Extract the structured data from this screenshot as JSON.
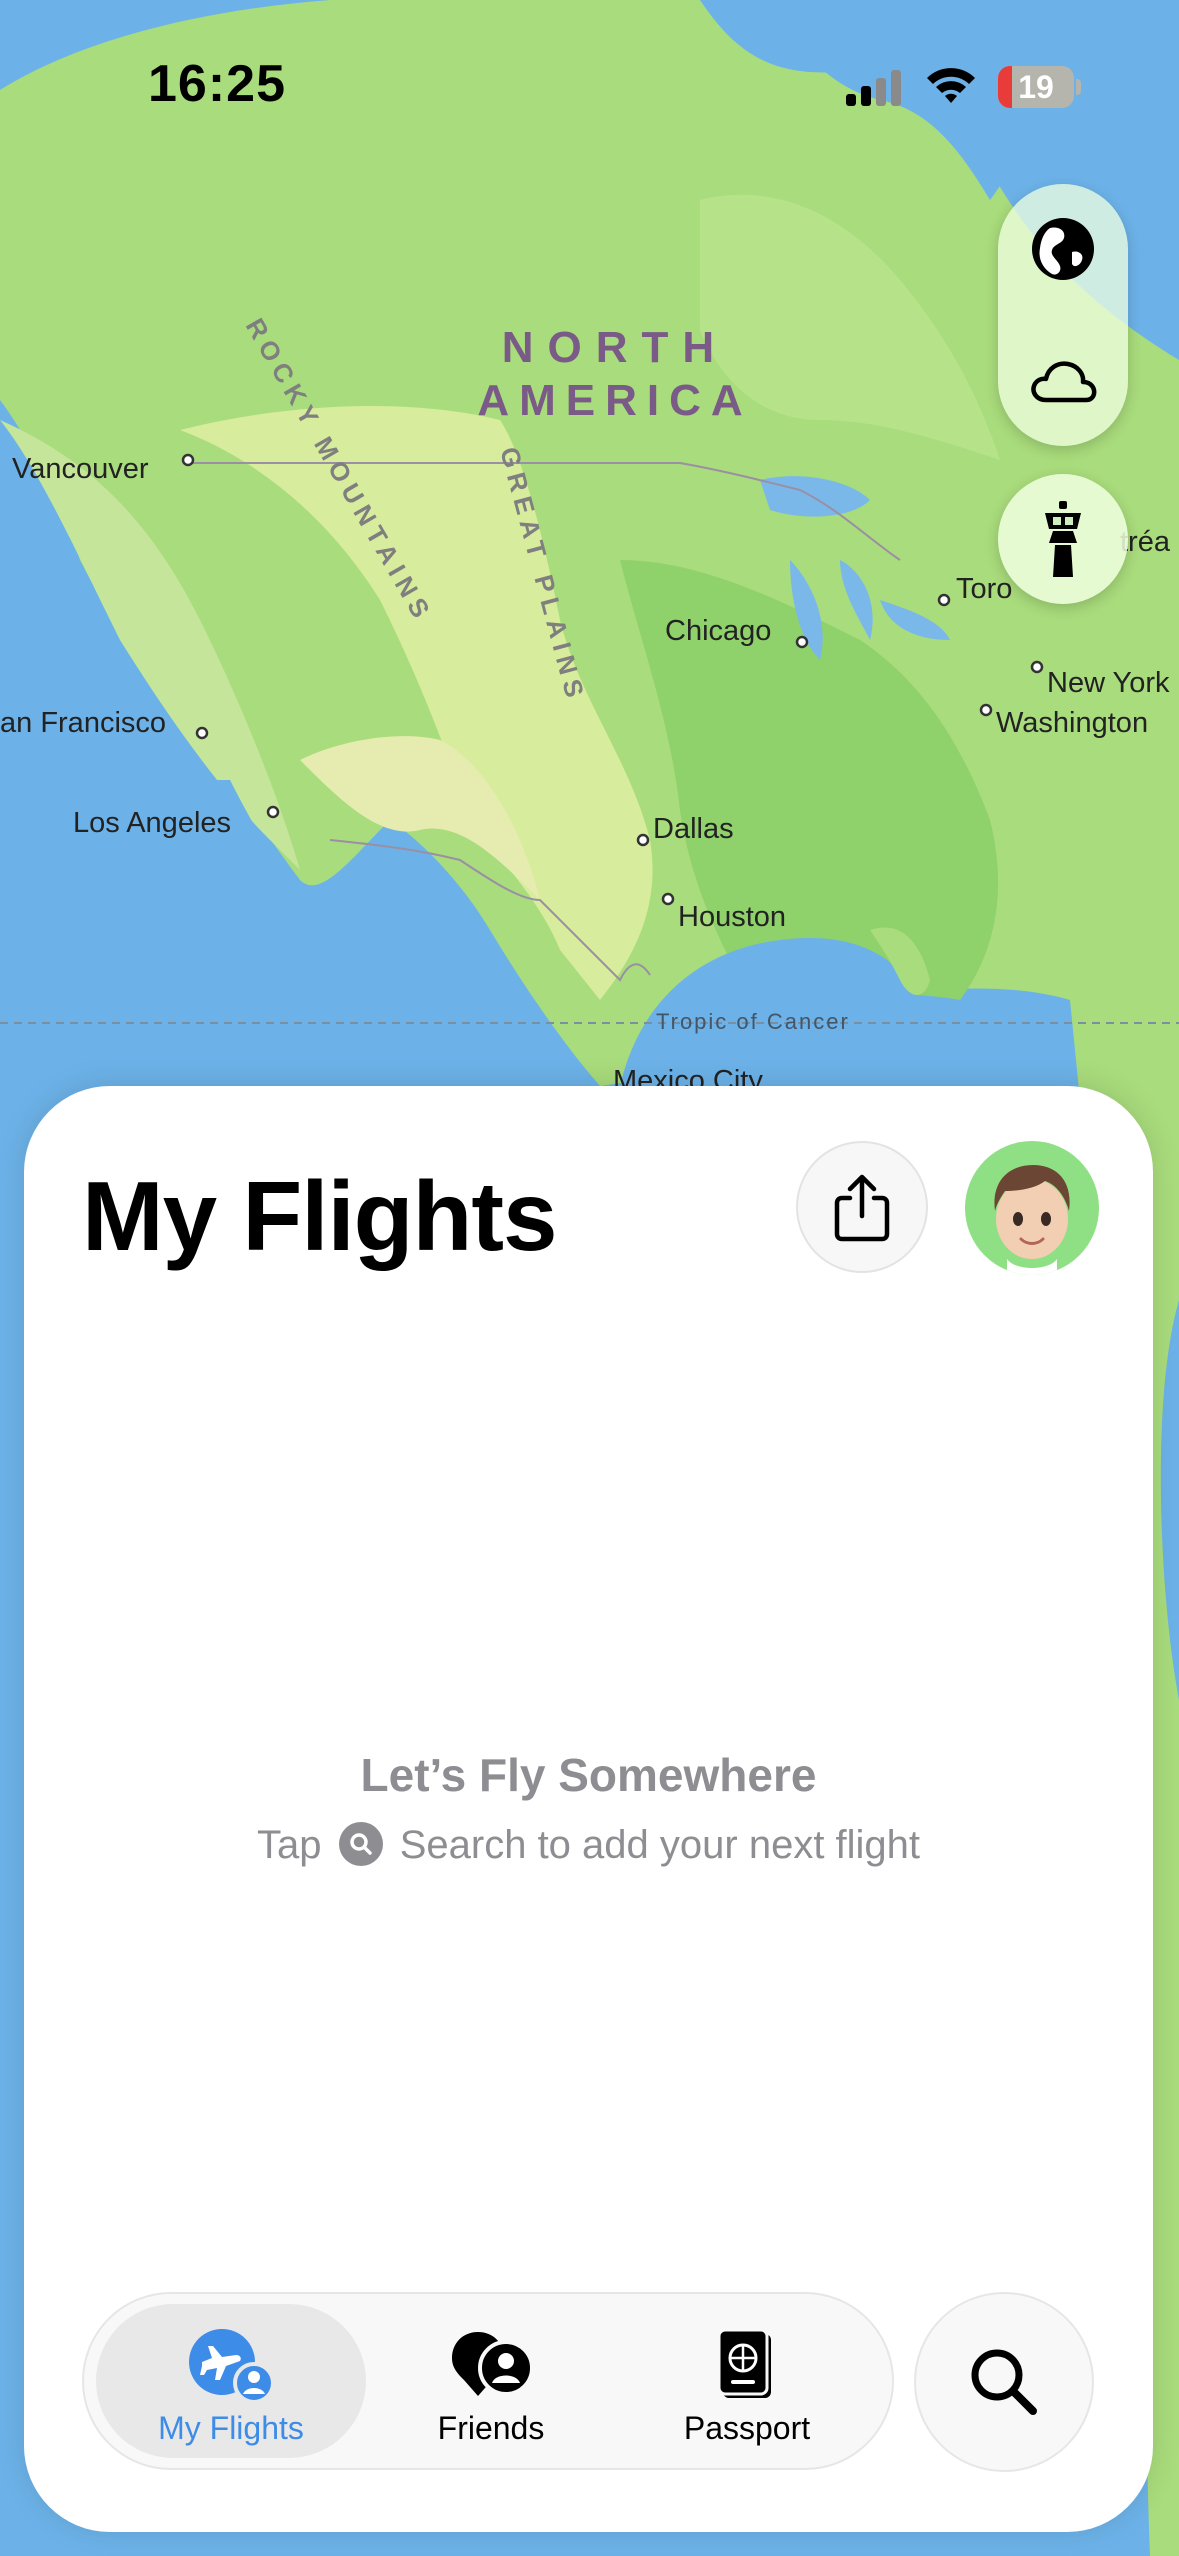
{
  "status_bar": {
    "time": "16:25",
    "battery_level": "19"
  },
  "map": {
    "continent_line1": "NORTH",
    "continent_line2": "AMERICA",
    "mountains": "ROCKY MOUNTAINS",
    "plains": "GREAT PLAINS",
    "tropic": "Tropic of Cancer",
    "cities": [
      "Vancouver",
      "Chicago",
      "Toro",
      "New York",
      "Washington",
      "an Francisco",
      "Los Angeles",
      "Dallas",
      "Houston",
      "Mexico City",
      "tréa"
    ]
  },
  "map_controls": {
    "globe_icon": "globe-icon",
    "weather_icon": "cloud-icon",
    "tower_icon": "control-tower-icon"
  },
  "sheet": {
    "title": "My Flights",
    "empty_title": "Let’s Fly Somewhere",
    "empty_prefix": "Tap",
    "empty_suffix": "Search to add your next flight"
  },
  "tabbar": {
    "tabs": [
      {
        "label": "My Flights",
        "icon": "plane-person-icon",
        "active": true
      },
      {
        "label": "Friends",
        "icon": "friends-icon",
        "active": false
      },
      {
        "label": "Passport",
        "icon": "passport-icon",
        "active": false
      }
    ],
    "search_icon": "magnifier-icon"
  },
  "colors": {
    "accent": "#3d8ce8",
    "ocean": "#6fb3e8",
    "land": "#a8dc7a",
    "sheet": "#ffffff"
  }
}
